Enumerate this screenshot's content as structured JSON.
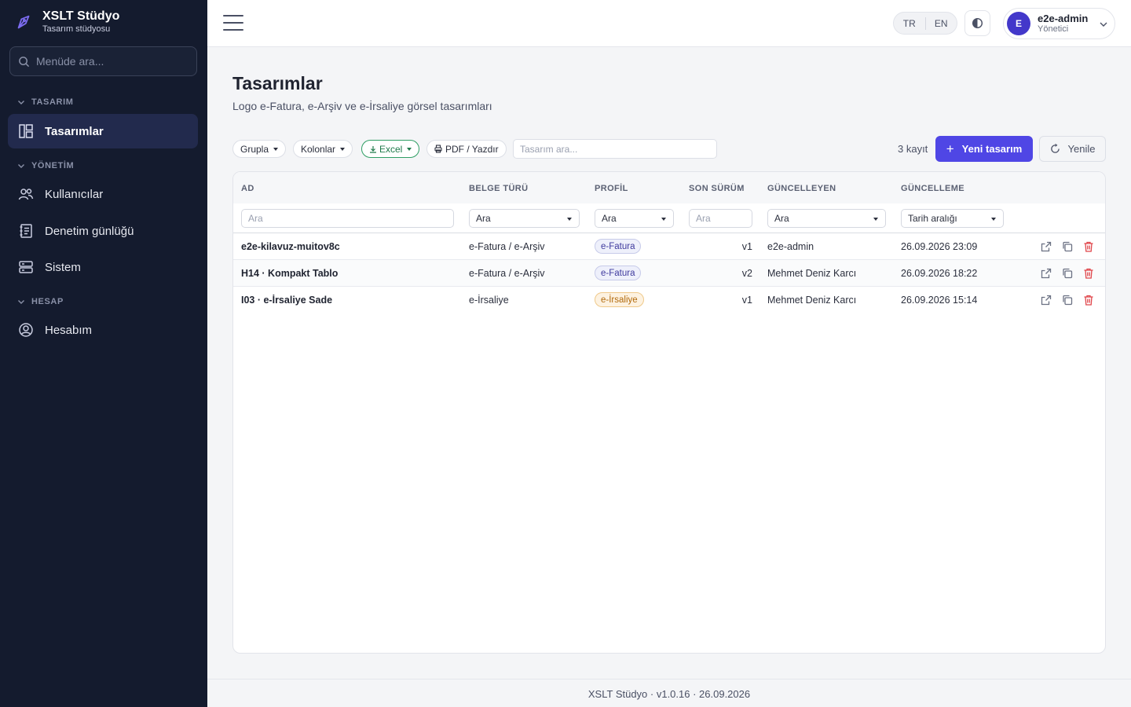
{
  "brand": {
    "title": "XSLT Stüdyo",
    "subtitle": "Tasarım stüdyosu"
  },
  "sidebar": {
    "search_placeholder": "Menüde ara...",
    "sections": [
      {
        "label": "TASARIM"
      },
      {
        "label": "YÖNETİM"
      },
      {
        "label": "HESAP"
      }
    ],
    "items": [
      {
        "label": "Tasarımlar",
        "icon": "layout-icon",
        "active": true
      },
      {
        "label": "Kullanıcılar",
        "icon": "users-icon"
      },
      {
        "label": "Denetim günlüğü",
        "icon": "audit-log-icon"
      },
      {
        "label": "Sistem",
        "icon": "server-icon"
      },
      {
        "label": "Hesabım",
        "icon": "user-circle-icon"
      }
    ]
  },
  "header": {
    "languages": [
      "TR",
      "EN"
    ],
    "user": {
      "initial": "E",
      "name": "e2e-admin",
      "role": "Yönetici"
    }
  },
  "page": {
    "title": "Tasarımlar",
    "subtitle": "Logo e-Fatura, e-Arşiv ve e-İrsaliye görsel tasarımları"
  },
  "toolbar": {
    "group_label": "Grupla",
    "columns_label": "Kolonlar",
    "excel_label": "Excel",
    "pdf_label": "PDF / Yazdır",
    "search_placeholder": "Tasarım ara...",
    "record_count": "3 kayıt",
    "new_label": "Yeni tasarım",
    "refresh_label": "Yenile"
  },
  "table": {
    "columns": [
      "AD",
      "BELGE TÜRÜ",
      "PROFİL",
      "SON SÜRÜM",
      "GÜNCELLEYEN",
      "GÜNCELLEME"
    ],
    "filters": {
      "name_placeholder": "Ara",
      "doc_type": "Ara",
      "profile": "Ara",
      "version_placeholder": "Ara",
      "updated_by": "Ara",
      "date_range": "Tarih aralığı"
    },
    "rows": [
      {
        "name": "e2e-kilavuz-muitov8c",
        "doc_type": "e-Fatura / e-Arşiv",
        "profile": "e-Fatura",
        "version": "v1",
        "updated_by": "e2e-admin",
        "updated_at": "26.09.2026 23:09"
      },
      {
        "name": "H14 · Kompakt Tablo",
        "doc_type": "e-Fatura / e-Arşiv",
        "profile": "e-Fatura",
        "version": "v2",
        "updated_by": "Mehmet Deniz Karcı",
        "updated_at": "26.09.2026 18:22"
      },
      {
        "name": "I03 · e-İrsaliye Sade",
        "doc_type": "e-İrsaliye",
        "profile": "e-İrsaliye",
        "version": "v1",
        "updated_by": "Mehmet Deniz Karcı",
        "updated_at": "26.09.2026 15:14"
      }
    ]
  },
  "footer": {
    "text": "XSLT Stüdyo · v1.0.16 · 26.09.2026"
  },
  "colors": {
    "sidebar_bg": "#141b2e",
    "accent": "#4f46e5",
    "excel": "#2f9e64",
    "delete": "#e0464b",
    "badge_fatura": "#3f3a9e",
    "badge_irsaliye": "#b26a0c"
  }
}
